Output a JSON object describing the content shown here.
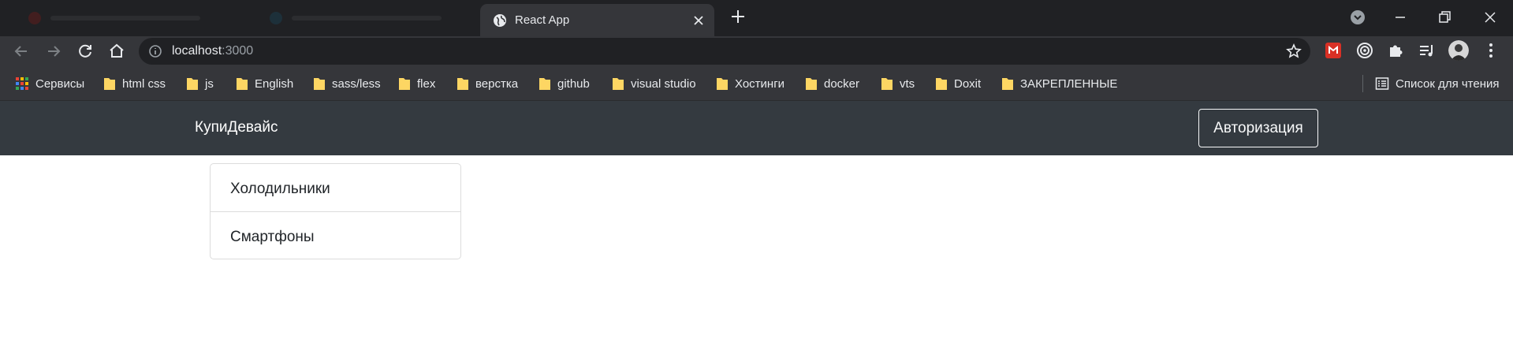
{
  "browser": {
    "tab": {
      "title": "React App"
    },
    "url": {
      "host": "localhost",
      "port": ":3000"
    },
    "bookmarks": [
      {
        "label": "Сервисы",
        "icon": "apps-grid-icon"
      },
      {
        "label": "html css",
        "icon": "folder-icon"
      },
      {
        "label": "js",
        "icon": "folder-icon"
      },
      {
        "label": "English",
        "icon": "folder-icon"
      },
      {
        "label": "sass/less",
        "icon": "folder-icon"
      },
      {
        "label": "flex",
        "icon": "folder-icon"
      },
      {
        "label": "верстка",
        "icon": "folder-icon"
      },
      {
        "label": "github",
        "icon": "folder-icon"
      },
      {
        "label": "visual studio",
        "icon": "folder-icon"
      },
      {
        "label": "Хостинги",
        "icon": "folder-icon"
      },
      {
        "label": "docker",
        "icon": "folder-icon"
      },
      {
        "label": "vts",
        "icon": "folder-icon"
      },
      {
        "label": "Doxit",
        "icon": "folder-icon"
      },
      {
        "label": "ЗАКРЕПЛЕННЫЕ",
        "icon": "folder-icon"
      }
    ],
    "reading_list": {
      "label": "Список для чтения",
      "icon": "reading-list-icon"
    }
  },
  "app": {
    "brand": "КупиДевайс",
    "auth_button": "Авторизация",
    "types": [
      {
        "label": "Холодильники"
      },
      {
        "label": "Смартфоны"
      }
    ]
  },
  "colors": {
    "chrome_tabstrip": "#202124",
    "chrome_toolbar": "#35363a",
    "navbar_bg": "#343a40",
    "folder_icon": "#fdd663"
  }
}
